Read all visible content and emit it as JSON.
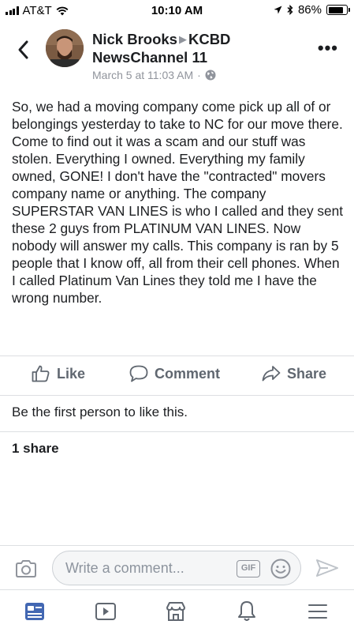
{
  "status_bar": {
    "carrier": "AT&T",
    "time": "10:10 AM",
    "battery": "86%",
    "battery_level": 0.86
  },
  "post": {
    "author": "Nick Brooks",
    "target": "KCBD NewsChannel 11",
    "timestamp": "March 5 at 11:03 AM",
    "separator": "·",
    "body": "So, we had a moving company come pick up all of or belongings yesterday to take to NC for our move there. Come to find out it was a scam and our stuff was stolen. Everything I owned. Everything my family owned, GONE! I don't have the \"contracted\" movers company name or anything. The company SUPERSTAR VAN LINES is who I called and they sent these 2 guys from PLATINUM VAN LINES. Now nobody will answer my calls. This company is ran by 5 people that I know off, all from their cell phones. When I called Platinum Van Lines they told me I have the wrong number."
  },
  "actions": {
    "like": "Like",
    "comment": "Comment",
    "share": "Share"
  },
  "reactions": {
    "likes_text": "Be the first person to like this.",
    "shares_text": "1 share"
  },
  "composer": {
    "placeholder": "Write a comment...",
    "gif_label": "GIF"
  },
  "icons": {
    "back": "back-chevron-icon",
    "more": "more-icon",
    "globe": "globe-icon",
    "camera": "camera-icon",
    "smile": "emoji-icon",
    "send": "send-icon",
    "tabs": [
      "news-feed-icon",
      "watch-icon",
      "marketplace-icon",
      "notifications-icon",
      "menu-icon"
    ]
  },
  "colors": {
    "accent": "#4267b2",
    "secondary_text": "#606770",
    "meta_text": "#90949c"
  }
}
